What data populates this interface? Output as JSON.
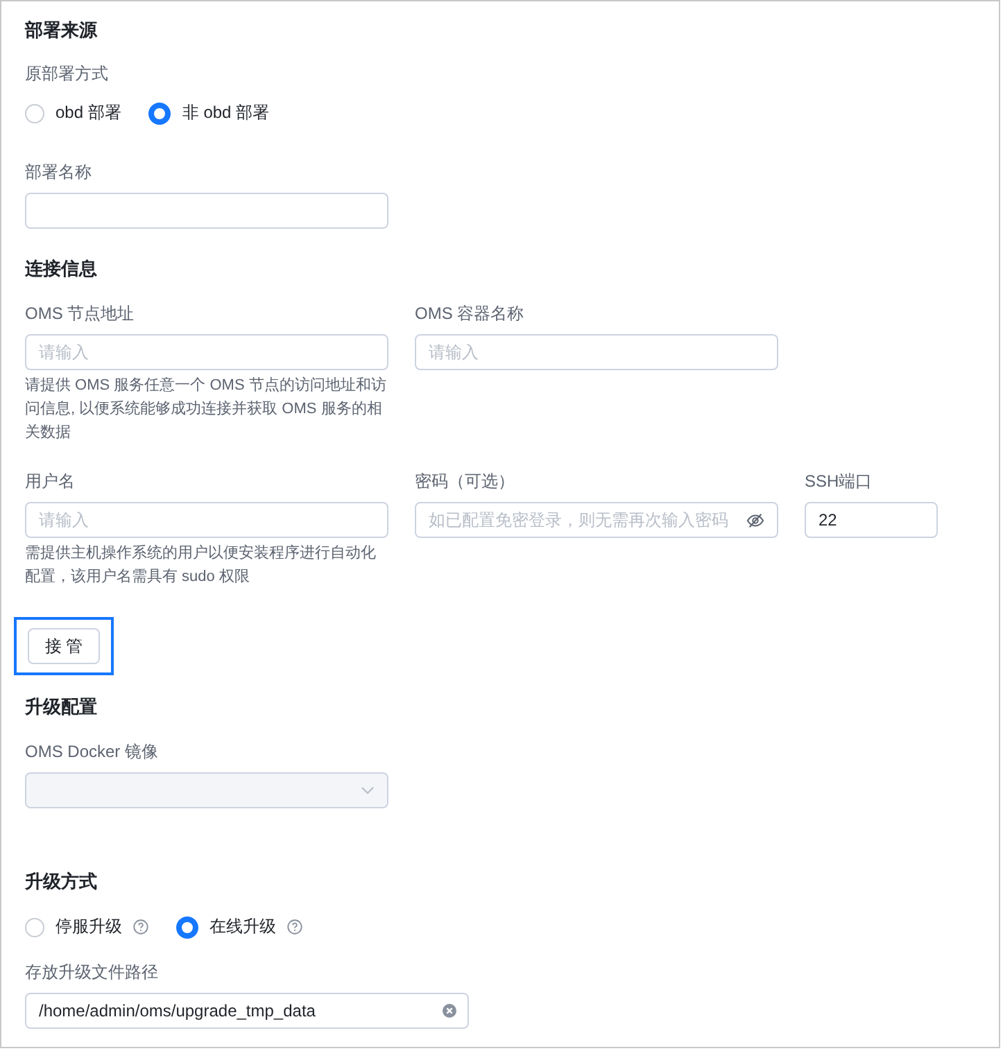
{
  "deploy_source": {
    "title": "部署来源",
    "method": {
      "label": "原部署方式",
      "options": [
        {
          "label": "obd 部署",
          "selected": false
        },
        {
          "label": "非 obd 部署",
          "selected": true
        }
      ]
    },
    "name": {
      "label": "部署名称"
    }
  },
  "connection": {
    "title": "连接信息",
    "row1": [
      {
        "label": "OMS 节点地址",
        "placeholder": "请输入",
        "help": "请提供 OMS 服务任意一个 OMS 节点的访问地址和访问信息, 以便系统能够成功连接并获取 OMS 服务的相关数据"
      },
      {
        "label": "OMS 容器名称",
        "placeholder": "请输入"
      }
    ],
    "row2": [
      {
        "kind": "text",
        "label": "用户名",
        "placeholder": "请输入",
        "help": "需提供主机操作系统的用户以便安装程序进行自动化配置，该用户名需具有 sudo 权限"
      },
      {
        "kind": "password",
        "label": "密码（可选）",
        "placeholder": "如已配置免密登录，则无需再次输入密码"
      },
      {
        "kind": "port",
        "label": "SSH端口",
        "value": "22"
      }
    ],
    "button": {
      "label": "接 管",
      "highlighted": true
    }
  },
  "upgrade_config": {
    "title": "升级配置",
    "image": {
      "label": "OMS Docker 镜像",
      "disabled": true
    }
  },
  "upgrade_method": {
    "title": "升级方式",
    "options": [
      {
        "label": "停服升级",
        "selected": false
      },
      {
        "label": "在线升级",
        "selected": true
      }
    ],
    "path": {
      "label": "存放升级文件路径",
      "value": "/home/admin/oms/upgrade_tmp_data"
    }
  }
}
